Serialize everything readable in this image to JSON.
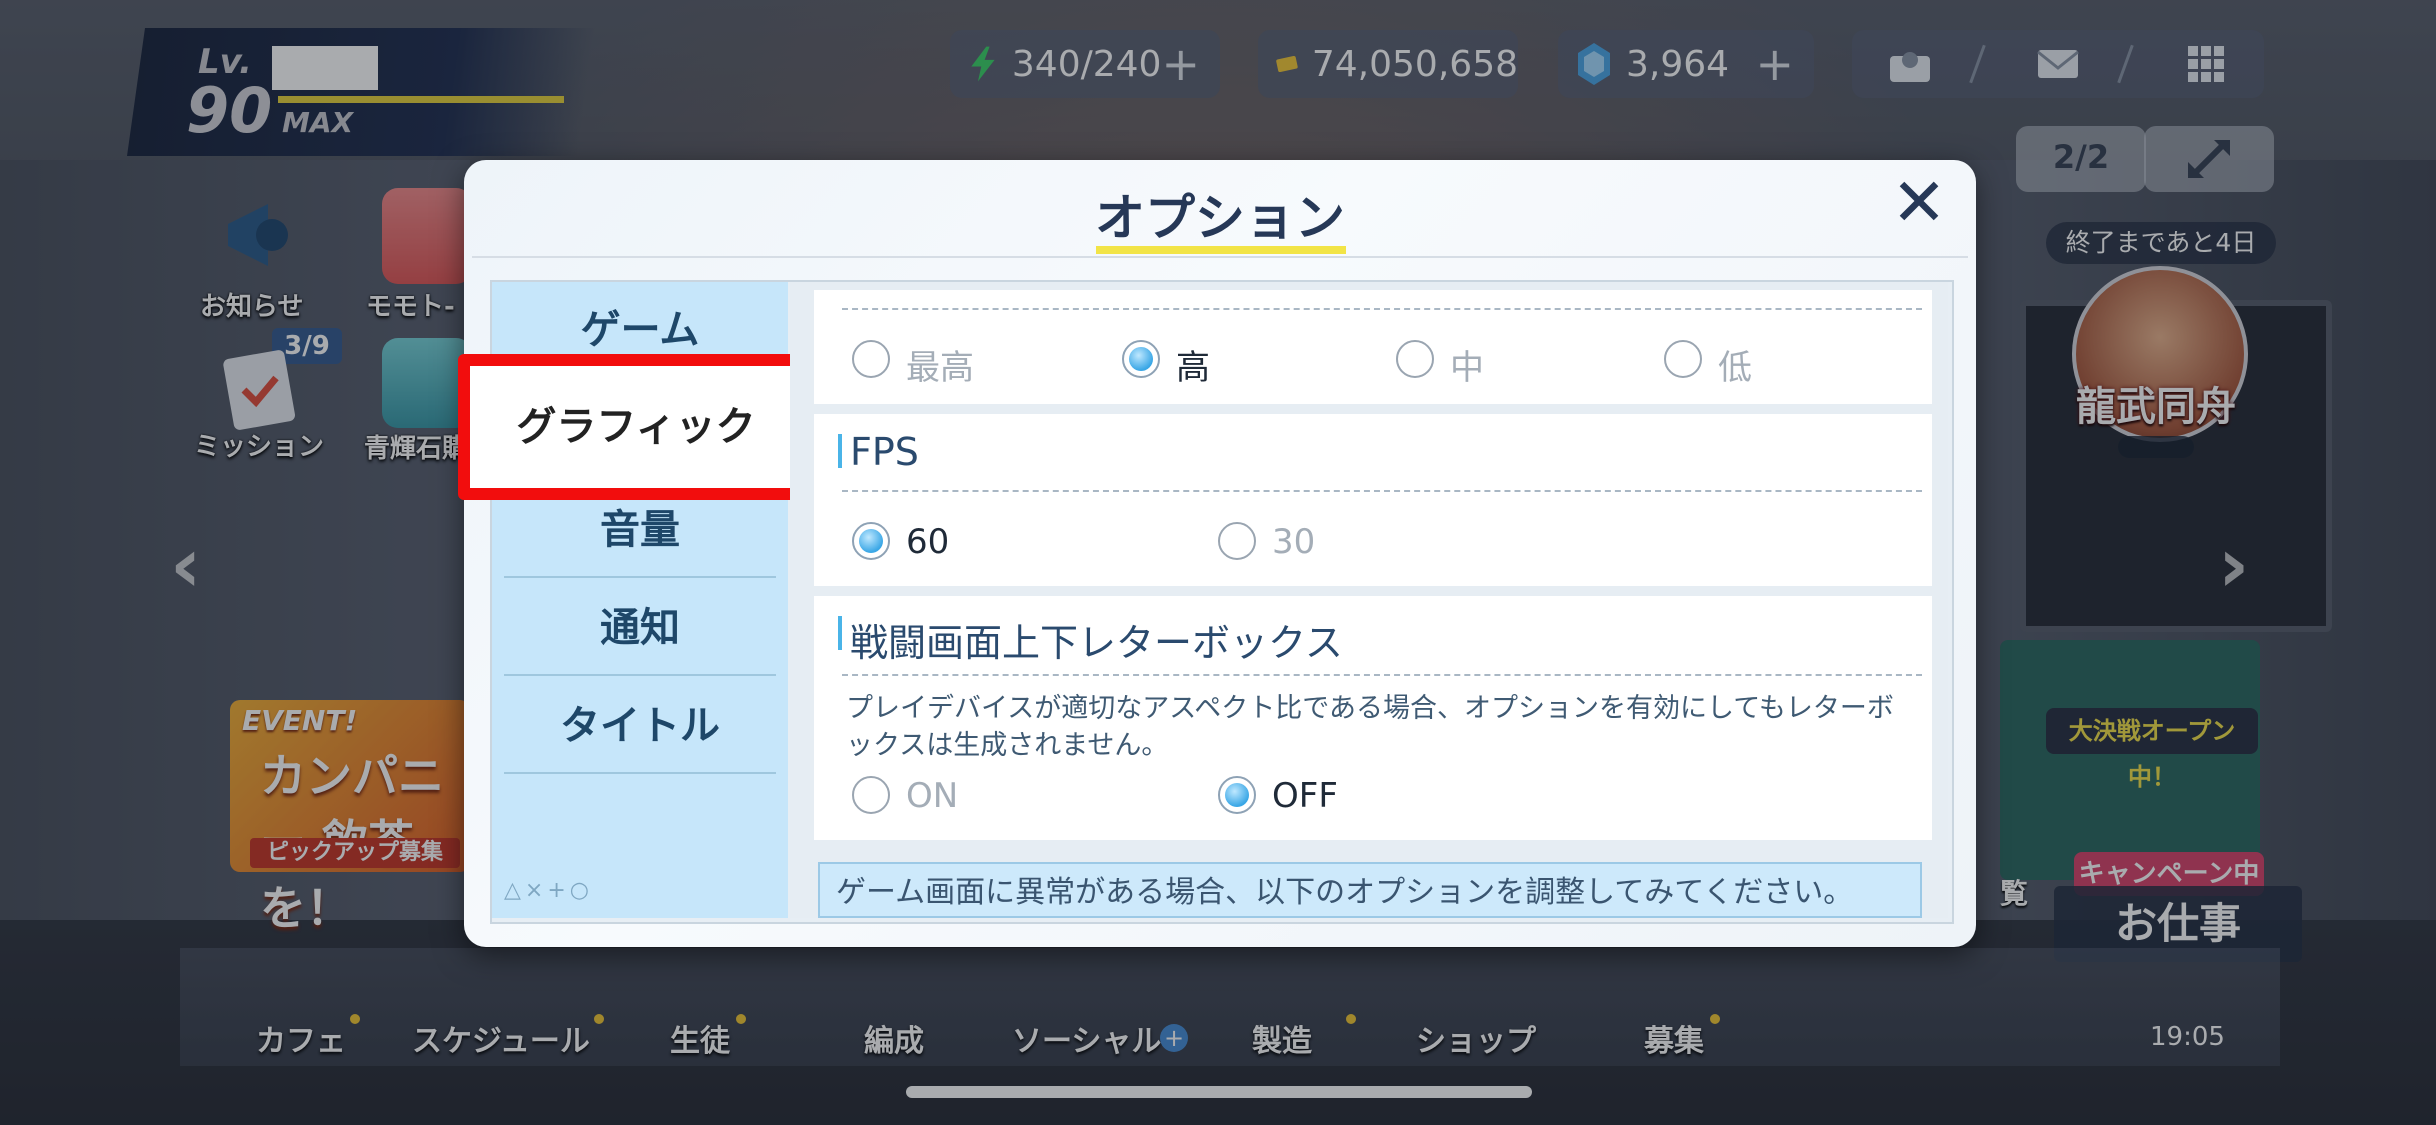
{
  "player": {
    "level_label": "Lv.",
    "level": "90",
    "max_label": "MAX"
  },
  "resources": {
    "ap": "340/240",
    "credits": "74,050,658",
    "gems": "3,964"
  },
  "hud": {
    "raid_counter": "2/2"
  },
  "left_side": {
    "notice_label": "お知らせ",
    "memolobby_label": "モモト-",
    "mission_label": "ミッション",
    "mission_badge": "3/9",
    "bluegem_label": "青輝石購",
    "event_banner_top": "EVENT!",
    "event_banner_title": "カンパニー 飲茶を！",
    "event_banner_sub": "ピックアップ募集"
  },
  "right_side": {
    "event_timer": "終了まであと4日",
    "event_name": "龍武同舟",
    "promo_top": "大決戦オープン中！",
    "promo_campaign": "キャンペーン中",
    "work_button": "お仕事",
    "side_label": "覧"
  },
  "bottom_menu": {
    "items": [
      "カフェ",
      "スケジュール",
      "生徒",
      "編成",
      "ソーシャル",
      "製造",
      "ショップ",
      "募集"
    ],
    "clock": "19:05"
  },
  "modal": {
    "title": "オプション",
    "nav": {
      "game": "ゲーム",
      "graphics": "グラフィック",
      "volume": "音量",
      "notification": "通知",
      "title": "タイトル"
    },
    "nav_symbols": "△×+○",
    "quality": {
      "options": [
        "最高",
        "高",
        "中",
        "低"
      ],
      "selected": "高"
    },
    "fps": {
      "label": "FPS",
      "options": [
        "60",
        "30"
      ],
      "selected": "60"
    },
    "letterbox": {
      "label": "戦闘画面上下レターボックス",
      "description": "プレイデバイスが適切なアスペクト比である場合、オプションを有効にしてもレターボックスは生成されません。",
      "options": [
        "ON",
        "OFF"
      ],
      "selected": "OFF"
    },
    "notice": "ゲーム画面に異常がある場合、以下のオプションを調整してみてください。"
  },
  "colors": {
    "highlight_border": "#f20d0d",
    "title_underline": "#f2e447",
    "nav_bg": "#c6e6fa",
    "radio_selected": "#3aa7e6",
    "accent_bar": "#4ab4e8"
  }
}
